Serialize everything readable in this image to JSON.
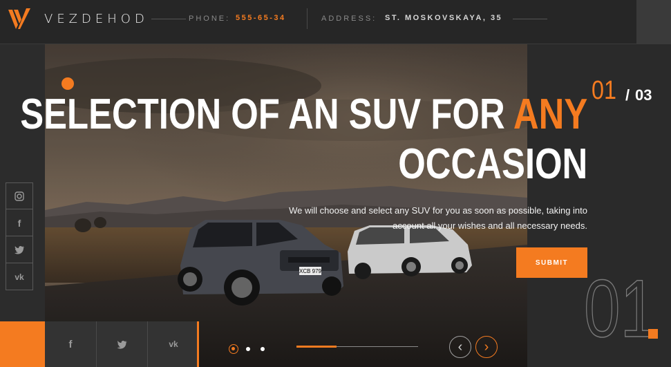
{
  "header": {
    "brand": "VEZDEHOD",
    "phone_label": "PHONE:",
    "phone_value": "555-65-34",
    "address_label": "ADDRESS:",
    "address_value": "ST. MOSKOVSKAYA, 35",
    "logo_icon": "v-logo-icon",
    "menu_icon": "menu-icon"
  },
  "hero": {
    "title_part1": "SELECTION OF AN SUV FOR ",
    "title_accent": "ANY",
    "title_part2": "OCCASION",
    "subtitle_line1": "We will choose and select any SUV for you as soon as possible, taking into",
    "subtitle_line2": "account all your wishes and all necessary needs.",
    "submit_label": "SUBMIT",
    "car_plate": "XCB 979"
  },
  "slider": {
    "current": "01",
    "separator": "/",
    "total": "03",
    "big_number": "01",
    "progress": 0.33,
    "prev_glyph": "‹",
    "next_glyph": "›"
  },
  "social_side": [
    {
      "icon": "instagram-icon",
      "glyph": "◎"
    },
    {
      "icon": "facebook-icon",
      "glyph": "f"
    },
    {
      "icon": "twitter-icon",
      "glyph": "𝕥"
    },
    {
      "icon": "vk-icon",
      "glyph": "vk"
    }
  ],
  "social_bottom": [
    {
      "icon": "facebook-icon",
      "glyph": "f"
    },
    {
      "icon": "twitter-icon",
      "glyph": "𝕥"
    },
    {
      "icon": "vk-icon",
      "glyph": "vk"
    }
  ],
  "colors": {
    "accent": "#f47b20",
    "background": "#2c2c2c",
    "header": "#262626"
  }
}
